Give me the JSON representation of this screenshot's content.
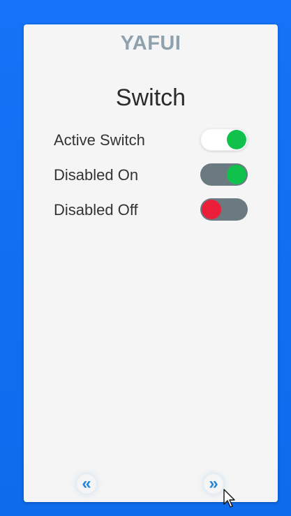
{
  "app": {
    "title": "YAFUI"
  },
  "page": {
    "title": "Switch"
  },
  "rows": [
    {
      "label": "Active Switch",
      "state": "on",
      "enabled": true
    },
    {
      "label": "Disabled On",
      "state": "on",
      "enabled": false
    },
    {
      "label": "Disabled Off",
      "state": "off",
      "enabled": false
    }
  ],
  "nav": {
    "prev_icon": "double-chevron-left-icon",
    "next_icon": "double-chevron-right-icon",
    "prev_glyph": "«",
    "next_glyph": "»"
  },
  "colors": {
    "background": "#0f6ff0",
    "card": "#f5f5f5",
    "title": "#8fa1ad",
    "on": "#10c24c",
    "off": "#ec1f3b",
    "disabled_track": "#6b7a81",
    "nav": "#2384d8"
  }
}
